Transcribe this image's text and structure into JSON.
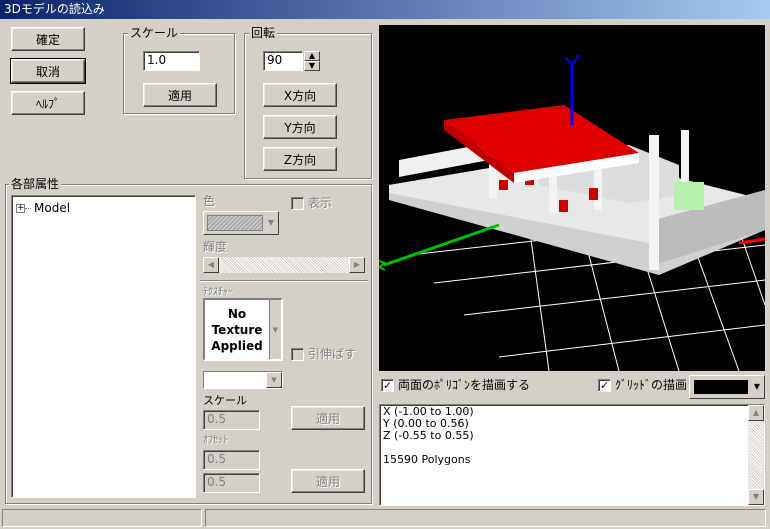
{
  "window": {
    "title": "3Dモデルの読込み"
  },
  "buttons": {
    "confirm": "確定",
    "cancel": "取消",
    "help": "ﾍﾙﾌﾟ"
  },
  "scale_group": {
    "label": "スケール",
    "value": "1.0",
    "apply": "適用"
  },
  "rotation_group": {
    "label": "回転",
    "value": "90",
    "x_dir": "X方向",
    "y_dir": "Y方向",
    "z_dir": "Z方向"
  },
  "parts": {
    "label": "各部属性",
    "tree_items": [
      {
        "expander": "+",
        "label": "Model"
      }
    ]
  },
  "attributes": {
    "color_label": "色",
    "show_label": "表示",
    "brightness_label": "輝度",
    "texture_label": "ﾃｸｽﾁｬｰ",
    "texture_preview": [
      "No",
      "Texture",
      "Applied"
    ],
    "stretch_label": "引伸ばす",
    "scale_label": "スケール",
    "scale_value": "0.5",
    "scale_apply": "適用",
    "offset_label": "ｵﾌｾｯﾄ",
    "offset_x": "0.5",
    "offset_y": "0.5",
    "offset_apply": "適用"
  },
  "viewport": {
    "background": "#000000",
    "axis_colors": {
      "x": "#ff0000",
      "y": "#0000ff",
      "z": "#00c000"
    },
    "grid_color": "#ffffff"
  },
  "render_options": {
    "double_sided": {
      "label": "両面のﾎﾟﾘｺﾞﾝを描画する",
      "checked": true
    },
    "grid": {
      "label": "ｸﾞﾘｯﾄﾞの描画",
      "checked": true
    },
    "bg_color": "#000000"
  },
  "info": {
    "lines": [
      "X (-1.00 to 1.00)",
      "Y (0.00 to 0.56)",
      "Z (-0.55 to 0.55)",
      "",
      "15590 Polygons"
    ]
  },
  "status_bar": {
    "segments": [
      "",
      ""
    ]
  }
}
